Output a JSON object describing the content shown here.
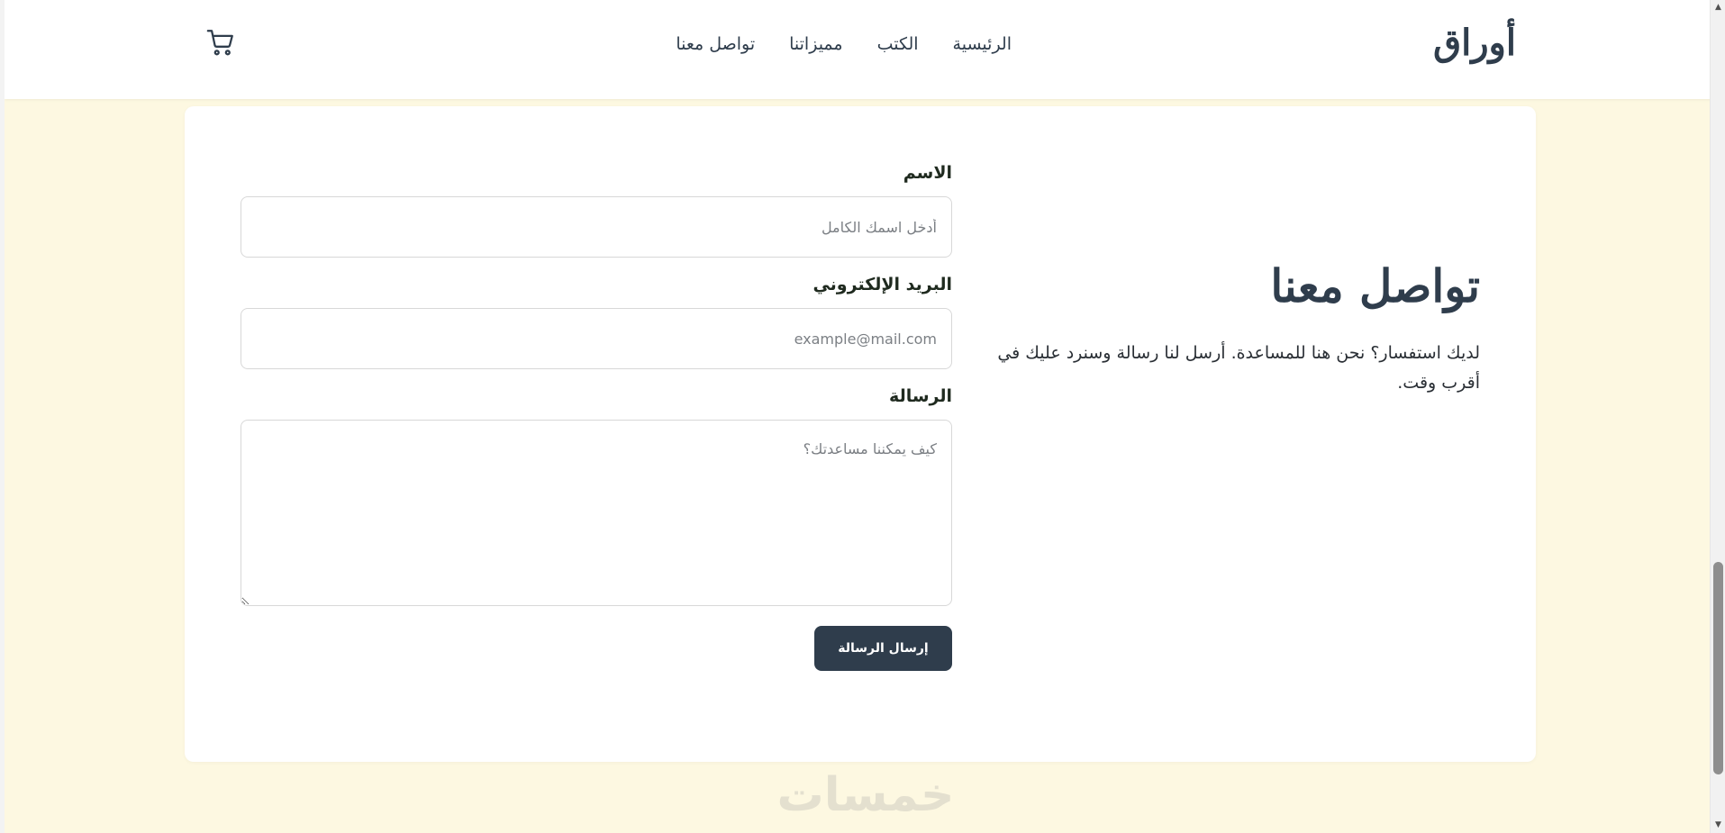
{
  "nav": {
    "logo": "أوراق",
    "links": [
      "الرئيسية",
      "الكتب",
      "مميزاتنا",
      "تواصل معنا"
    ],
    "cart_icon": "cart-icon"
  },
  "contact": {
    "title": "تواصل معنا",
    "description": "لديك استفسار؟ نحن هنا للمساعدة. أرسل لنا رسالة وسنرد عليك في أقرب وقت."
  },
  "form": {
    "name_label": "الاسم",
    "name_placeholder": "أدخل اسمك الكامل",
    "email_label": "البريد الإلكتروني",
    "email_placeholder": "example@mail.com",
    "message_label": "الرسالة",
    "message_placeholder": "كيف يمكننا مساعدتك؟",
    "submit_label": "إرسال الرسالة"
  },
  "watermark": {
    "text": "خمسات"
  },
  "colors": {
    "primary": "#2f3d4c",
    "page_background": "#fdf8e1",
    "card_background": "#ffffff"
  }
}
